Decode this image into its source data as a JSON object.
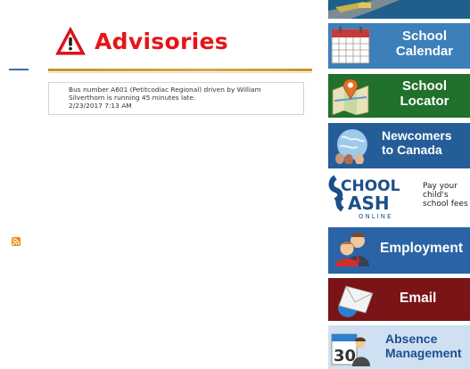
{
  "advisories": {
    "title": "Advisories",
    "notice": {
      "message": "Bus number A601 (Petitcodiac Regional) driven by William Silverthorn is running 45 minutes late.",
      "timestamp": "2/23/2017 7:13 AM"
    },
    "rss_icon": "rss-feed-icon"
  },
  "sidebar": {
    "school_calendar": {
      "line1": "School",
      "line2": "Calendar",
      "icon": "calendar-icon"
    },
    "school_locator": {
      "line1": "School",
      "line2": "Locator",
      "icon": "map-pin-icon"
    },
    "newcomers": {
      "line1": "Newcomers",
      "line2": "to Canada",
      "icon": "globe-icon"
    },
    "school_cash": {
      "logo_line1": "CHOOL",
      "logo_line2": "ASH",
      "logo_line3": "ONLINE",
      "text1": "Pay your",
      "text2": "child's",
      "text3": "school fees"
    },
    "employment": {
      "label": "Employment",
      "icon": "people-icon"
    },
    "email": {
      "label": "Email",
      "icon": "envelope-icon"
    },
    "absence": {
      "line1": "Absence",
      "line2": "Management",
      "badge": "30",
      "icon": "calendar-30-icon"
    }
  },
  "colors": {
    "advisory_red": "#e4151a",
    "calendar_blue": "#3c7fb9",
    "locator_green": "#21702b",
    "newcomers_blue": "#245d98",
    "employment_blue": "#2a64a6",
    "email_maroon": "#7a1416",
    "absence_light": "#cfe0f2"
  }
}
